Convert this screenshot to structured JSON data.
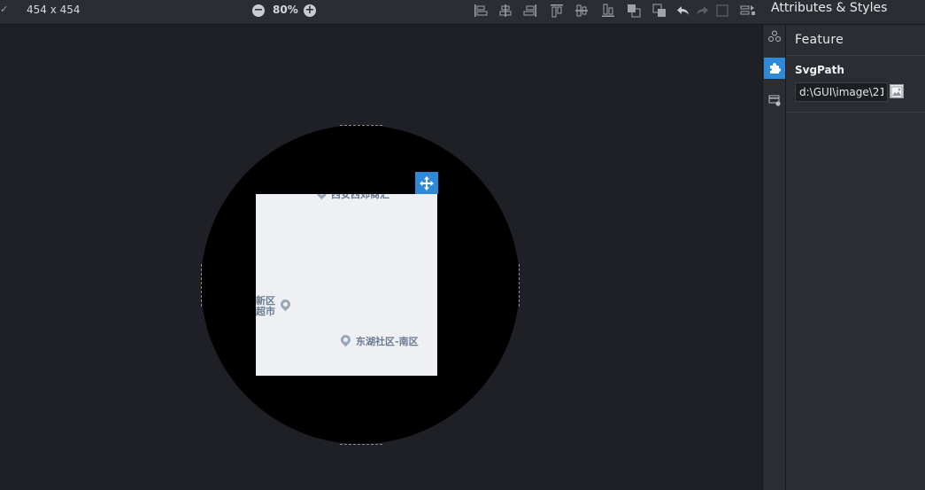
{
  "toolbar": {
    "check_glyph": "✓",
    "canvas_size": "454 x 454",
    "zoom": "80%",
    "zoom_out_icon": "minus-circle-icon",
    "zoom_in_icon": "plus-circle-icon"
  },
  "panel": {
    "title": "Attributes & Styles",
    "section": "Feature",
    "field_label": "SvgPath",
    "field_value": "d:\\GUI\\image\\21"
  },
  "map_labels": {
    "top": "西安西郊商汇",
    "left_line1": "新区",
    "left_line2": "超市",
    "bottom_right": "东湖社区-南区"
  },
  "colors": {
    "accent": "#2e8ad8",
    "toolbar_bg": "#2b2d33",
    "canvas_bg": "#1e2026",
    "map_bg": "#eef0f3"
  }
}
